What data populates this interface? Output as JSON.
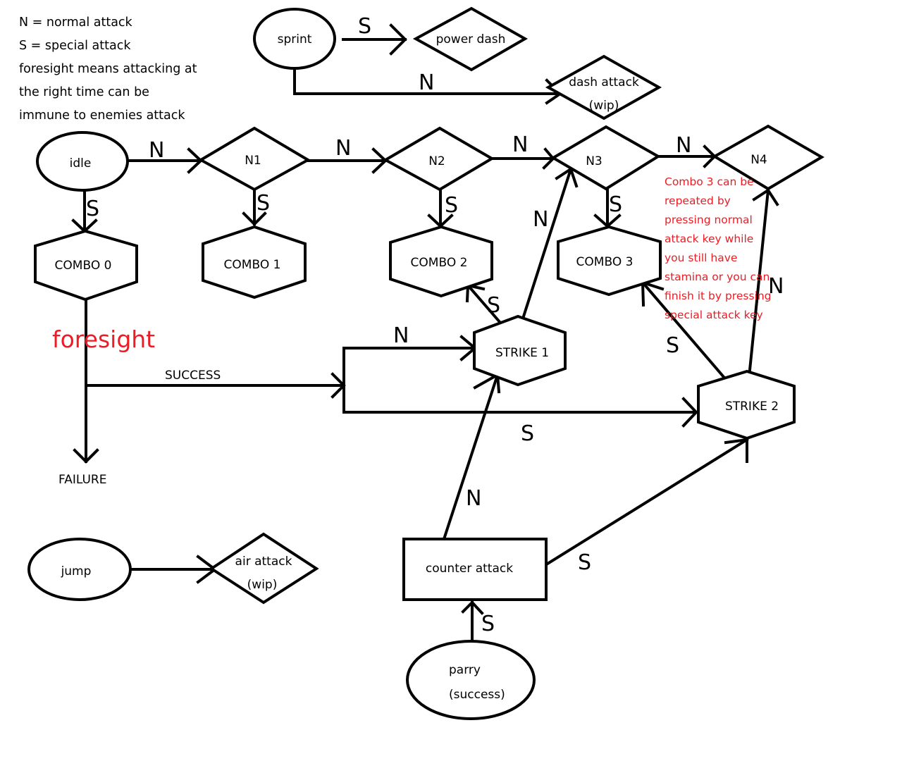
{
  "legend": {
    "lines": [
      "N = normal attack",
      "S = special attack",
      "foresight means attacking at",
      "the right time can be",
      "immune to enemies attack"
    ]
  },
  "colors": {
    "stroke": "#000000",
    "annotation": "#ed1c24",
    "background": "#ffffff"
  },
  "nodes": {
    "sprint": {
      "shape": "ellipse",
      "label": "sprint"
    },
    "power_dash": {
      "shape": "diamond",
      "label": "power dash"
    },
    "dash_attack": {
      "shape": "diamond",
      "label_lines": [
        "dash attack",
        "(wip)"
      ]
    },
    "idle": {
      "shape": "ellipse",
      "label": "idle"
    },
    "n1": {
      "shape": "diamond",
      "label": "N1"
    },
    "n2": {
      "shape": "diamond",
      "label": "N2"
    },
    "n3": {
      "shape": "diamond",
      "label": "N3"
    },
    "n4": {
      "shape": "diamond",
      "label": "N4"
    },
    "combo0": {
      "shape": "hexagon",
      "label": "COMBO 0"
    },
    "combo1": {
      "shape": "hexagon",
      "label": "COMBO 1"
    },
    "combo2": {
      "shape": "hexagon",
      "label": "COMBO 2"
    },
    "combo3": {
      "shape": "hexagon",
      "label": "COMBO 3"
    },
    "strike1": {
      "shape": "hexagon",
      "label": "STRIKE 1"
    },
    "strike2": {
      "shape": "hexagon",
      "label": "STRIKE 2"
    },
    "failure": {
      "shape": "text",
      "label": "FAILURE"
    },
    "jump": {
      "shape": "ellipse",
      "label": "jump"
    },
    "air_attack": {
      "shape": "diamond",
      "label_lines": [
        "air attack",
        "(wip)"
      ]
    },
    "counter_attack": {
      "shape": "rectangle",
      "label": "counter attack"
    },
    "parry": {
      "shape": "ellipse",
      "label_lines": [
        "parry",
        "(success)"
      ]
    }
  },
  "edges": [
    {
      "from": "sprint",
      "to": "power_dash",
      "label": "S"
    },
    {
      "from": "sprint",
      "to": "dash_attack",
      "label": "N"
    },
    {
      "from": "idle",
      "to": "n1",
      "label": "N"
    },
    {
      "from": "n1",
      "to": "n2",
      "label": "N"
    },
    {
      "from": "n2",
      "to": "n3",
      "label": "N"
    },
    {
      "from": "n3",
      "to": "n4",
      "label": "N"
    },
    {
      "from": "idle",
      "to": "combo0",
      "label": "S"
    },
    {
      "from": "n1",
      "to": "combo1",
      "label": "S"
    },
    {
      "from": "n2",
      "to": "combo2",
      "label": "S"
    },
    {
      "from": "n3",
      "to": "combo3",
      "label": "S"
    },
    {
      "from": "combo0",
      "to": "strike1/strike2",
      "label": "SUCCESS"
    },
    {
      "from": "combo0",
      "to": "failure",
      "label": ""
    },
    {
      "from": "success_branch",
      "to": "strike1",
      "label": "N"
    },
    {
      "from": "success_branch",
      "to": "strike2",
      "label": "S"
    },
    {
      "from": "strike1",
      "to": "combo2",
      "label": "S"
    },
    {
      "from": "strike1",
      "to": "n3",
      "label": "N"
    },
    {
      "from": "strike2",
      "to": "combo3",
      "label": "S"
    },
    {
      "from": "strike2",
      "to": "n4",
      "label": "N"
    },
    {
      "from": "counter_attack",
      "to": "strike1",
      "label": "N"
    },
    {
      "from": "counter_attack",
      "to": "strike2",
      "label": "S"
    },
    {
      "from": "parry",
      "to": "counter_attack",
      "label": "S"
    },
    {
      "from": "jump",
      "to": "air_attack",
      "label": ""
    }
  ],
  "annotations": {
    "foresight": "foresight",
    "combo3_note": [
      "Combo 3 can be",
      "repeated by",
      "pressing normal",
      "attack key while",
      "you still have",
      "stamina or you can",
      "finish it by pressing",
      "special attack key"
    ]
  }
}
